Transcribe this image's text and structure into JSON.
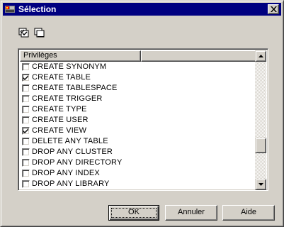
{
  "window": {
    "title": "Sélection",
    "close_label": "Close"
  },
  "toolbar": {
    "buttons": [
      {
        "name": "select-all-icon"
      },
      {
        "name": "deselect-all-icon"
      }
    ]
  },
  "list": {
    "columns": [
      "Privilèges",
      ""
    ],
    "rows": [
      {
        "label": "CREATE SYNONYM",
        "checked": false
      },
      {
        "label": "CREATE TABLE",
        "checked": true
      },
      {
        "label": "CREATE TABLESPACE",
        "checked": false
      },
      {
        "label": "CREATE TRIGGER",
        "checked": false
      },
      {
        "label": "CREATE TYPE",
        "checked": false
      },
      {
        "label": "CREATE USER",
        "checked": false
      },
      {
        "label": "CREATE VIEW",
        "checked": true
      },
      {
        "label": "DELETE ANY TABLE",
        "checked": false
      },
      {
        "label": "DROP ANY CLUSTER",
        "checked": false
      },
      {
        "label": "DROP ANY DIRECTORY",
        "checked": false
      },
      {
        "label": "DROP ANY INDEX",
        "checked": false
      },
      {
        "label": "DROP ANY LIBRARY",
        "checked": false
      }
    ],
    "scroll_position": 0.75
  },
  "buttons": {
    "ok": "OK",
    "cancel": "Annuler",
    "help": "Aide"
  },
  "colors": {
    "titlebar": "#000080",
    "face": "#d4d0c8"
  }
}
